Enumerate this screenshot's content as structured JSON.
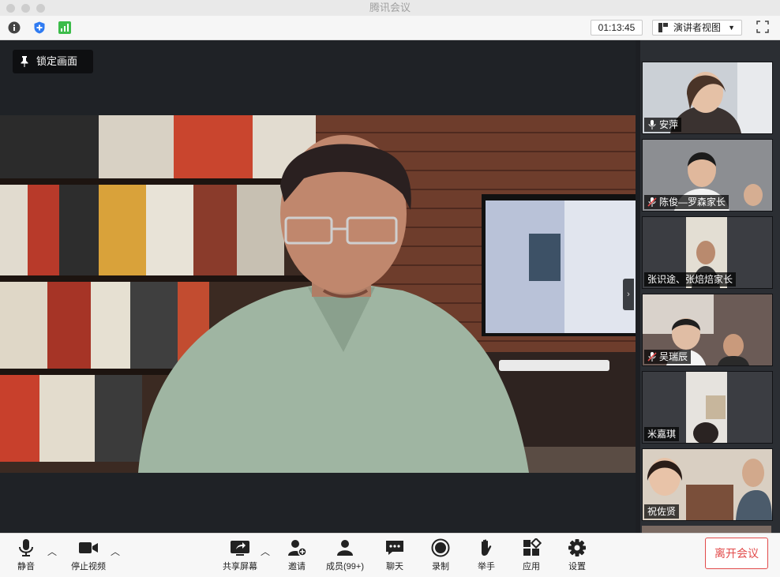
{
  "window": {
    "title": "腾讯会议"
  },
  "infobar": {
    "timer": "01:13:45",
    "view_mode": "演讲者视图"
  },
  "stage": {
    "lock_label": "锁定画面"
  },
  "participants": [
    {
      "name": "安萍",
      "mic": "on"
    },
    {
      "name": "陈俊—罗森家长",
      "mic": "muted"
    },
    {
      "name": "张识途、张焙焙家长",
      "mic": "none"
    },
    {
      "name": "吴瑞辰",
      "mic": "muted"
    },
    {
      "name": "米嘉琪",
      "mic": "none"
    },
    {
      "name": "祝佐贤",
      "mic": "none"
    }
  ],
  "toolbar": {
    "mute": "静音",
    "stop_video": "停止视频",
    "share_screen": "共享屏幕",
    "invite": "邀请",
    "members": "成员(99+)",
    "chat": "聊天",
    "record": "录制",
    "raise_hand": "举手",
    "apps": "应用",
    "settings": "设置",
    "leave": "离开会议"
  },
  "colors": {
    "leave_red": "#e24a4a",
    "signal_green": "#3cbc4a",
    "shield_blue": "#2f7bf2"
  }
}
